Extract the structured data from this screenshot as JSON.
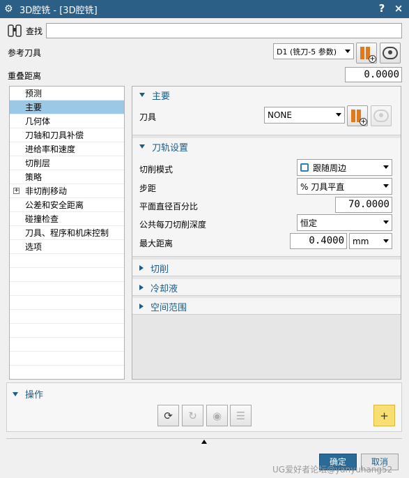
{
  "window": {
    "title": "3D腔铣 - [3D腔铣]",
    "help_label": "?",
    "close_label": "×"
  },
  "find": {
    "label": "查找",
    "value": ""
  },
  "reference_tool": {
    "label": "参考刀具",
    "selected": "D1 (铣刀-5 参数)"
  },
  "overlap_distance": {
    "label": "重叠距离",
    "value": "0.0000"
  },
  "tree": {
    "items": [
      {
        "label": "预测",
        "selected": false,
        "expandable": false
      },
      {
        "label": "主要",
        "selected": true,
        "expandable": false
      },
      {
        "label": "几何体",
        "selected": false,
        "expandable": false
      },
      {
        "label": "刀轴和刀具补偿",
        "selected": false,
        "expandable": false
      },
      {
        "label": "进给率和速度",
        "selected": false,
        "expandable": false
      },
      {
        "label": "切削层",
        "selected": false,
        "expandable": false
      },
      {
        "label": "策略",
        "selected": false,
        "expandable": false
      },
      {
        "label": "非切削移动",
        "selected": false,
        "expandable": true
      },
      {
        "label": "公差和安全距离",
        "selected": false,
        "expandable": false
      },
      {
        "label": "碰撞检查",
        "selected": false,
        "expandable": false
      },
      {
        "label": "刀具、程序和机床控制",
        "selected": false,
        "expandable": false
      },
      {
        "label": "选项",
        "selected": false,
        "expandable": false
      }
    ]
  },
  "main_group": {
    "header": "主要",
    "tool_label": "刀具",
    "tool_value": "NONE"
  },
  "toolpath_group": {
    "header": "刀轨设置",
    "cut_pattern_label": "切削模式",
    "cut_pattern_value": "跟随周边",
    "stepover_label": "步距",
    "stepover_value": "% 刀具平直",
    "percent_label": "平面直径百分比",
    "percent_value": "70.0000",
    "common_depth_label": "公共每刀切削深度",
    "common_depth_value": "恒定",
    "max_distance_label": "最大距离",
    "max_distance_value": "0.4000",
    "max_distance_unit": "mm"
  },
  "collapsed_groups": {
    "cutting": "切削",
    "coolant": "冷却液",
    "spatial_range": "空间范围"
  },
  "operations": {
    "header": "操作"
  },
  "buttons": {
    "ok": "确定",
    "cancel": "取消"
  },
  "watermark": "UG爱好者论坛@yanyuhang52",
  "icons": {
    "gear": "gear-icon",
    "find": "binoculars-icon",
    "tool_new": "new-tool-icon",
    "display": "display-tool-icon",
    "generate": "generate-icon",
    "replay": "replay-icon",
    "verify": "verify-icon",
    "list": "list-icon",
    "add": "add-icon"
  },
  "colors": {
    "titlebar": "#2b5f86",
    "accent": "#1b5c8a",
    "selection": "#9bc8e4",
    "ok_button": "#2b6a97"
  }
}
